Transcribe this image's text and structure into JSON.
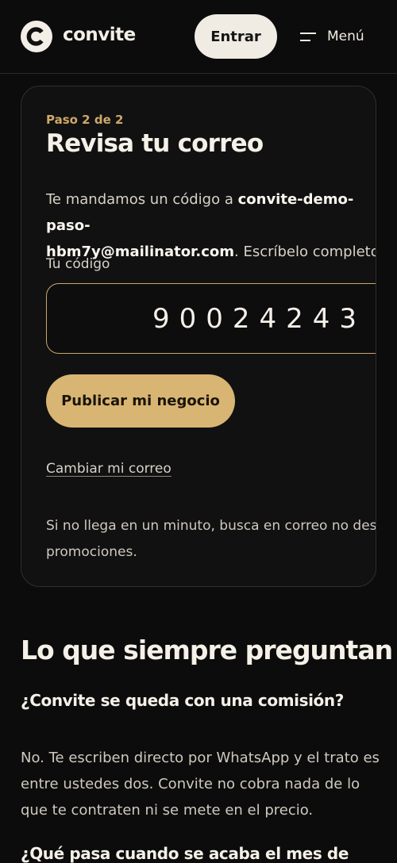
{
  "header": {
    "brand": "convite",
    "login_label": "Entrar",
    "menu_label": "Menú"
  },
  "card": {
    "step": "Paso 2 de 2",
    "title": "Revisa tu correo",
    "desc_prefix": "Te mandamos un código a ",
    "desc_email_line1": "convite-demo-paso-",
    "desc_email_line2": "hbm7y@mailinator.com",
    "desc_suffix": ". Escríbelo completo.",
    "code_label": "Tu código",
    "code_value": "90024243",
    "publish_label": "Publicar mi negocio",
    "change_email_label": "Cambiar mi correo",
    "hint_line1": "Si no llega en un minuto, busca en correo no desea",
    "hint_line2": "promociones."
  },
  "faq": {
    "title": "Lo que siempre preguntan",
    "q1": "¿Convite se queda con una comisión?",
    "a1": "No. Te escriben directo por WhatsApp y el trato es entre ustedes dos. Convite no cobra nada de lo que te contraten ni se mete en el precio.",
    "q2": "¿Qué pasa cuando se acaba el mes de"
  },
  "icons": {
    "logo": "convite-logo-icon",
    "menu": "menu-icon"
  },
  "colors": {
    "accent": "#d9b574",
    "step": "#cfa86a",
    "background": "#0c0c0c"
  }
}
